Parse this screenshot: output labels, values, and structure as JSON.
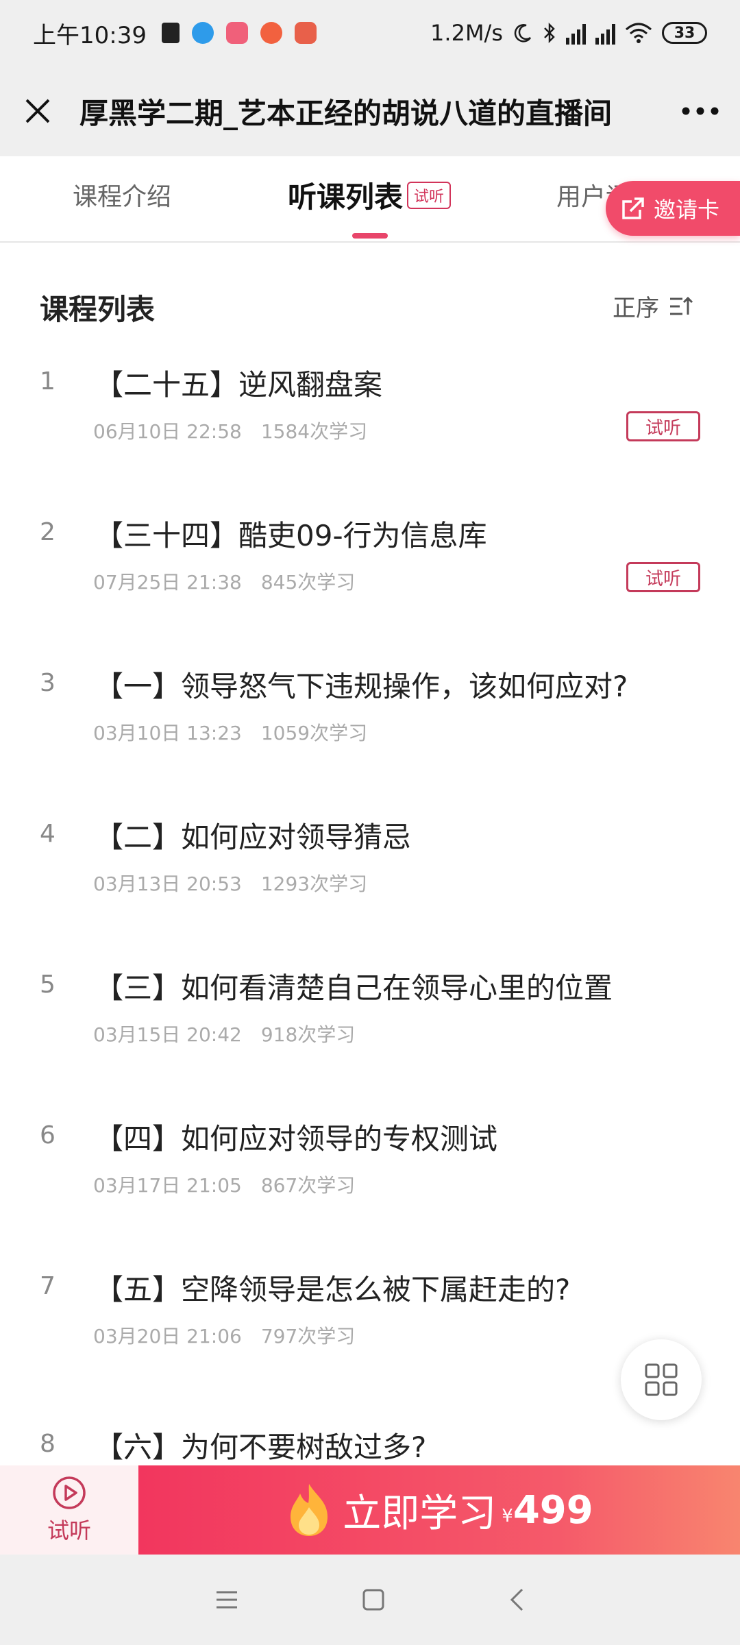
{
  "status_bar": {
    "time": "上午10:39",
    "network_speed": "1.2M/s",
    "battery": "33",
    "icons": [
      "moon-icon",
      "bluetooth-icon",
      "hd-signal-icon",
      "hd-signal-icon",
      "wifi-icon",
      "battery-icon"
    ]
  },
  "title_bar": {
    "title": "厚黑学二期_艺本正经的胡说八道的直播间",
    "close_icon": "close-icon",
    "more_icon": "more-icon"
  },
  "tabs": {
    "intro": "课程介绍",
    "list": "听课列表",
    "list_badge": "试听",
    "review": "用户评价 3",
    "invite": "邀请卡"
  },
  "section": {
    "title": "课程列表",
    "sort_label": "正序"
  },
  "lessons": [
    {
      "num": "1",
      "title": "【二十五】逆风翻盘案",
      "date": "06月10日 22:58",
      "views": "1584次学习",
      "tag": "试听"
    },
    {
      "num": "2",
      "title": "【三十四】酷吏09-行为信息库",
      "date": "07月25日 21:38",
      "views": "845次学习",
      "tag": "试听"
    },
    {
      "num": "3",
      "title": "【一】领导怒气下违规操作，该如何应对?",
      "date": "03月10日 13:23",
      "views": "1059次学习",
      "tag": ""
    },
    {
      "num": "4",
      "title": "【二】如何应对领导猜忌",
      "date": "03月13日 20:53",
      "views": "1293次学习",
      "tag": ""
    },
    {
      "num": "5",
      "title": "【三】如何看清楚自己在领导心里的位置",
      "date": "03月15日 20:42",
      "views": "918次学习",
      "tag": ""
    },
    {
      "num": "6",
      "title": "【四】如何应对领导的专权测试",
      "date": "03月17日 21:05",
      "views": "867次学习",
      "tag": ""
    },
    {
      "num": "7",
      "title": "【五】空降领导是怎么被下属赶走的?",
      "date": "03月20日 21:06",
      "views": "797次学习",
      "tag": ""
    },
    {
      "num": "8",
      "title": "【六】为何不要树敌过多?",
      "date": "",
      "views": "",
      "tag": ""
    }
  ],
  "bottom_bar": {
    "trial_label": "试听",
    "study_label": "立即学习",
    "price_symbol": "¥",
    "price": "499"
  },
  "colors": {
    "accent": "#e8456a",
    "tag_border": "#c43a5a"
  }
}
